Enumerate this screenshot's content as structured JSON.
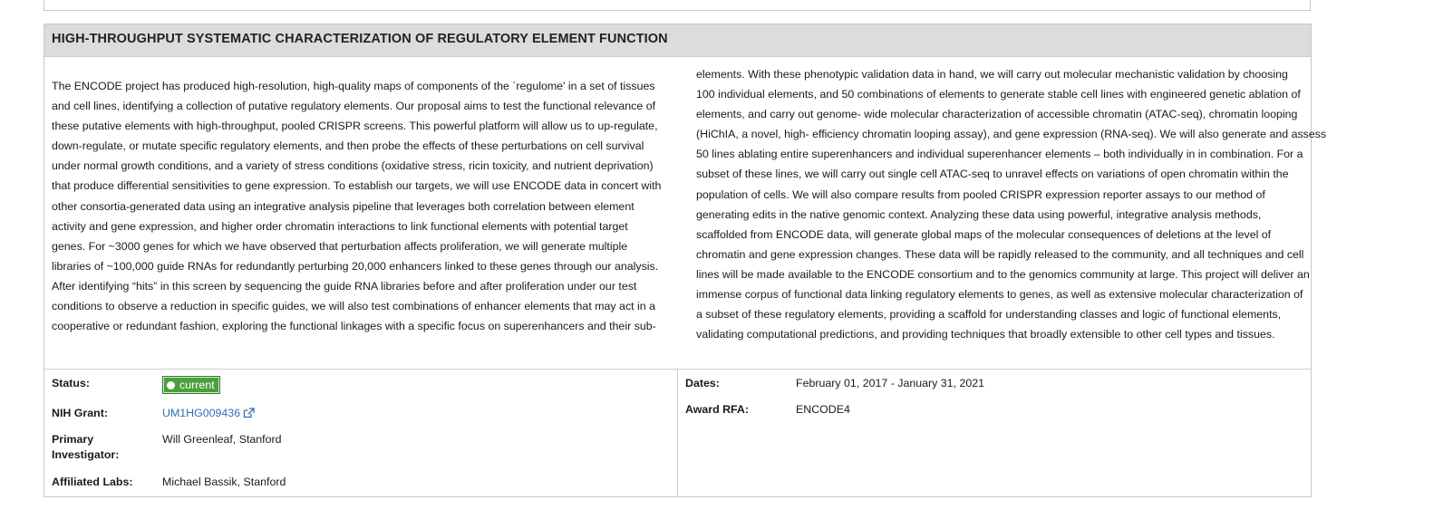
{
  "panel": {
    "title": "HIGH-THROUGHPUT SYSTEMATIC CHARACTERIZATION OF REGULATORY ELEMENT FUNCTION"
  },
  "description": {
    "left_lines": [
      "The ENCODE project has produced high-resolution, high-quality maps of components of the `regulome' in a set of tissues",
      "and cell lines, identifying a collection of putative regulatory elements. Our proposal aims to test the functional relevance of",
      "these putative elements with high-throughput, pooled CRISPR screens. This powerful platform will allow us to up-regulate,",
      "down-regulate, or mutate specific regulatory elements, and then probe the effects of these perturbations on cell survival",
      "under normal growth conditions, and a variety of stress conditions (oxidative stress, ricin toxicity, and nutrient deprivation)",
      "that produce differential sensitivities to gene expression. To establish our targets, we will use ENCODE data in concert with",
      "other consortia-generated data using an integrative analysis pipeline that leverages both correlation between element",
      "activity and gene expression, and higher order chromatin interactions to link functional elements with potential target",
      "genes. For ~3000 genes for which we have observed that perturbation affects proliferation, we will generate multiple",
      "libraries of ~100,000 guide RNAs for redundantly perturbing 20,000 enhancers linked to these genes through our analysis.",
      "After identifying “hits” in this screen by sequencing the guide RNA libraries before and after proliferation under our test",
      "conditions to observe a reduction in specific guides, we will also test combinations of enhancer elements that may act in a",
      "cooperative or redundant fashion, exploring the functional linkages with a specific focus on superenhancers and their sub-"
    ],
    "right_lines": [
      "elements. With these phenotypic validation data in hand, we will carry out molecular mechanistic validation by choosing",
      "100 individual elements, and 50 combinations of elements to generate stable cell lines with engineered genetic ablation of",
      "elements, and carry out genome- wide molecular characterization of accessible chromatin (ATAC-seq), chromatin looping",
      "(HiChIA, a novel, high- efficiency chromatin looping assay), and gene expression (RNA-seq). We will also generate and assess",
      "50 lines ablating entire superenhancers and individual superenhancer elements – both individually in in combination. For a",
      "subset of these lines, we will carry out single cell ATAC-seq to unravel effects on variations of open chromatin within the",
      "population of cells. We will also compare results from pooled CRISPR expression reporter assays to our method of",
      "generating edits in the native genomic context. Analyzing these data using powerful, integrative analysis methods,",
      "scaffolded from ENCODE data, will generate global maps of the molecular consequences of deletions at the level of",
      "chromatin and gene expression changes. These data will be rapidly released to the community, and all techniques and cell",
      "lines will be made available to the ENCODE consortium and to the genomics community at large. This project will deliver an",
      "immense corpus of functional data linking regulatory elements to genes, as well as extensive molecular characterization of",
      "a subset of these regulatory elements, providing a scaffold for understanding classes and logic of functional elements,",
      "validating computational predictions, and providing techniques that broadly extensible to other cell types and tissues."
    ]
  },
  "meta": {
    "status_label": "Status:",
    "status_value": "current",
    "status_color": "#4b9f3d",
    "grant_label": "NIH Grant:",
    "grant_value": "UM1HG009436",
    "grant_icon": "external-link-icon",
    "pi_label_line1": "Primary",
    "pi_label_line2": "Investigator:",
    "pi_value": "Will Greenleaf, Stanford",
    "labs_label": "Affiliated Labs:",
    "labs_value": "Michael Bassik, Stanford",
    "dates_label": "Dates:",
    "dates_value": "February 01, 2017 - January 31, 2021",
    "rfa_label": "Award RFA:",
    "rfa_value": "ENCODE4"
  }
}
